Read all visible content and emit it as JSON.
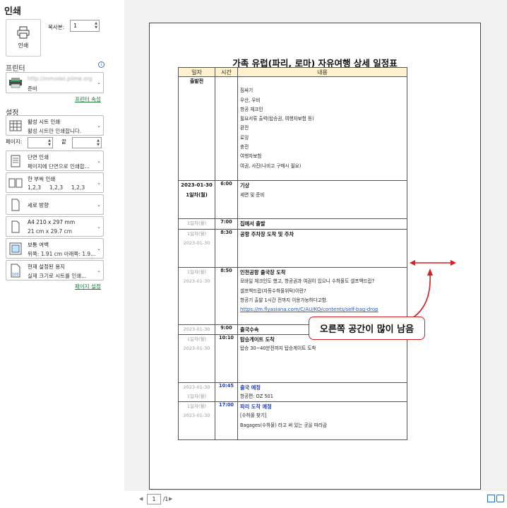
{
  "header": {
    "title": "인쇄"
  },
  "print_button": {
    "label": "인쇄"
  },
  "copies": {
    "label": "복사본:",
    "value": "1"
  },
  "printer": {
    "section_title": "프린터",
    "name": "http://mmodel.pilme.org",
    "status": "준비",
    "properties_link": "프린터 속성"
  },
  "settings": {
    "section_title": "설정",
    "print_what": {
      "title": "활성 시트 인쇄",
      "subtitle": "활성 시트만 인쇄합니다."
    },
    "pages": {
      "label": "페이지:",
      "to_label": "끝"
    },
    "sides": {
      "title": "단면 인쇄",
      "subtitle": "페이지에 단면으로 인쇄합..."
    },
    "collate": {
      "title": "한 부씩 인쇄",
      "subtitle": "1,2,3     1,2,3     1,2,3"
    },
    "orientation": {
      "title": "세로 방향"
    },
    "paper": {
      "title": "A4 210 x 297 mm",
      "subtitle": "21 cm x 29.7 cm"
    },
    "margins": {
      "title": "보통 여백",
      "subtitle": "위쪽: 1.91 cm 아래쪽: 1.9..."
    },
    "scaling": {
      "title": "현재 설정된 용지",
      "subtitle": "실제 크기로 시트를 인쇄...",
      "icon_text": "100"
    },
    "page_setup_link": "페이지 설정"
  },
  "document": {
    "title": "가족 유럽(파리, 로마) 자유여행 상세 일정표",
    "headers": [
      "일자",
      "시간",
      "내용"
    ],
    "pre_departure": {
      "date": "출발전",
      "items": [
        "짐싸기",
        "우산, 우비",
        "항공 체크인",
        "필요서류 출력(탑승권, 여행자보험 등)",
        "환전",
        "로밍",
        "충전",
        "여행자보험",
        "여권, 사진(나비고 구매시 필요)"
      ]
    },
    "rows": [
      {
        "d1": "2023-01-30",
        "d2": "1일차(월)",
        "time": "6:00",
        "heading": "기상",
        "lines": [
          "세면 및 준비"
        ],
        "extra": 2
      },
      {
        "d1": "1일차(월)",
        "d2": "",
        "time": "7:00",
        "heading": "집에서 출발",
        "lines": [],
        "extra": 0
      },
      {
        "d1": "1일차(월)",
        "d2": "2023-01-30",
        "time": "8:30",
        "heading": "공항 주차장 도착 및 주차",
        "lines": [],
        "extra": 3
      },
      {
        "d1": "1일차(월)",
        "d2": "2023-01-30",
        "time": "8:50",
        "heading": "인천공항 출국장 도착",
        "lines": [
          "모바일 체크인도 했고, 항공권과 여권이 있으니 수하물도 셀프백드랍?",
          "셀프백드랍(자동수하물위탁)이란?",
          "항공기 출발 1시간 전까지 이용가능하다고함."
        ],
        "url": "https://m.flyasiana.com/C/AU/KO/contents/self-bag-drop",
        "extra": 1
      },
      {
        "d1": "2023-01-30",
        "d2": "",
        "time": "9:00",
        "heading": "출국수속",
        "lines": [],
        "extra": 0
      },
      {
        "d1": "1일차(월)",
        "d2": "2023-01-30",
        "time": "10:10",
        "heading": "탑승게이트 도착",
        "lines": [
          "탑승 30~40분전까지 탑승게이트 도착"
        ],
        "extra": 3
      },
      {
        "d1": "2023-01-30",
        "d2": "1일차(월)",
        "time": "10:45",
        "heading": "출국 예정",
        "lines": [
          "항공편: OZ 501"
        ],
        "extra": 0,
        "blue": true
      },
      {
        "d1": "1일차(월)",
        "d2": "2023-01-30",
        "time": "17:00",
        "heading": "파리 도착 예정",
        "lines": [
          "[수하물 찾기]",
          "Bagages(수하물) 라고 써 있는 곳을 따라감"
        ],
        "extra": 1,
        "blue": true
      }
    ]
  },
  "annotation": {
    "text": "오른쪽 공간이 많이 남음",
    "color": "#d42020"
  },
  "pager": {
    "current": "1",
    "total": "/1"
  }
}
